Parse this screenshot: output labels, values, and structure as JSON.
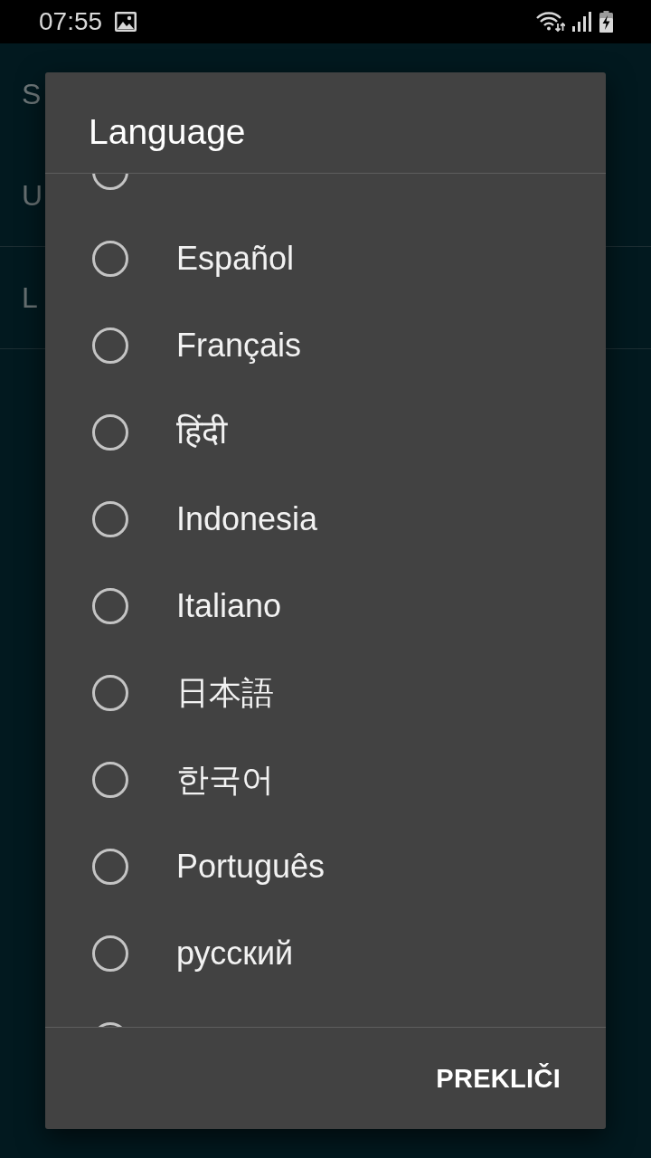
{
  "status_bar": {
    "time": "07:55"
  },
  "background_screen": {
    "title": "S",
    "rows": [
      "U",
      "L"
    ]
  },
  "dialog": {
    "title": "Language",
    "options": [
      {
        "selected": false
      },
      {
        "label": "Español",
        "selected": false
      },
      {
        "label": "Français",
        "selected": false
      },
      {
        "label": "हिंदी",
        "selected": false
      },
      {
        "label": "Indonesia",
        "selected": false
      },
      {
        "label": "Italiano",
        "selected": false
      },
      {
        "label": "日本語",
        "selected": false
      },
      {
        "label": "한국어",
        "selected": false
      },
      {
        "label": "Português",
        "selected": false
      },
      {
        "label": "русский",
        "selected": false
      },
      {
        "selected": false
      }
    ],
    "cancel_button": "PREKLIČI"
  }
}
